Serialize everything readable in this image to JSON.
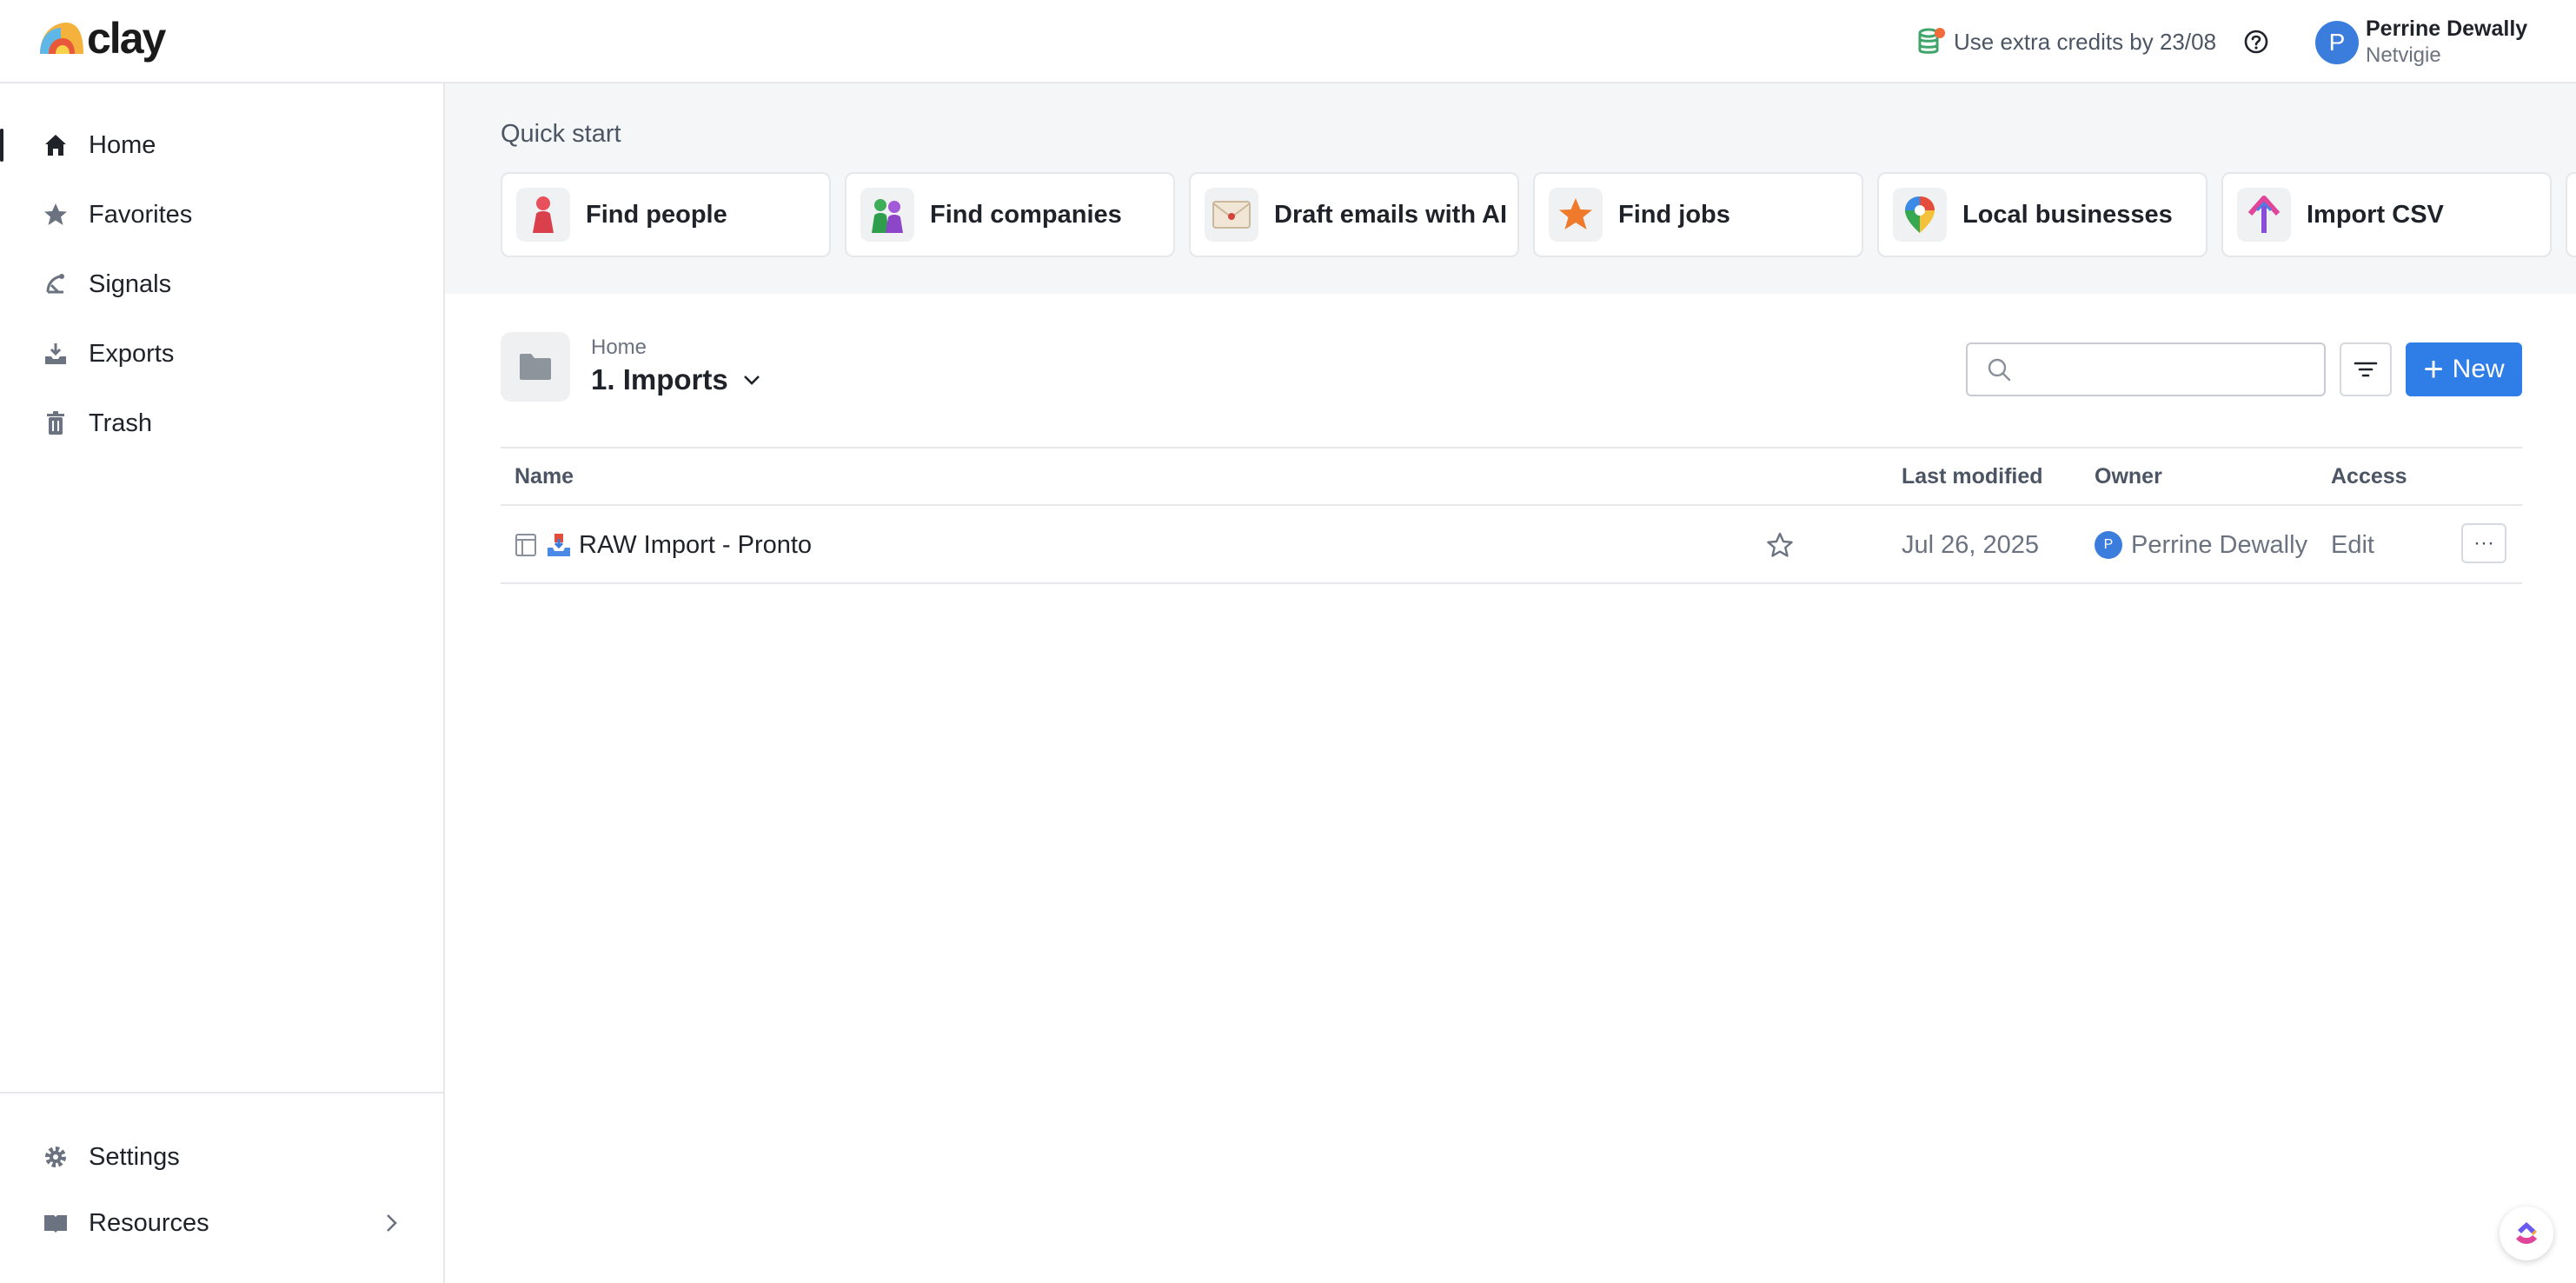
{
  "app": {
    "logo_text": "clay"
  },
  "topbar": {
    "credits_text": "Use extra credits by 23/08",
    "user": {
      "initial": "P",
      "name": "Perrine Dewally",
      "org": "Netvigie"
    }
  },
  "sidebar": {
    "items": [
      {
        "label": "Home",
        "icon": "home-icon",
        "active": true
      },
      {
        "label": "Favorites",
        "icon": "star-icon"
      },
      {
        "label": "Signals",
        "icon": "signal-icon"
      },
      {
        "label": "Exports",
        "icon": "export-tray-icon"
      },
      {
        "label": "Trash",
        "icon": "trash-icon"
      }
    ],
    "bottom": [
      {
        "label": "Settings",
        "icon": "gear-icon"
      },
      {
        "label": "Resources",
        "icon": "book-icon"
      }
    ]
  },
  "quickstart": {
    "title": "Quick start",
    "cards": [
      {
        "label": "Find people",
        "icon": "person-icon"
      },
      {
        "label": "Find companies",
        "icon": "people-group-icon"
      },
      {
        "label": "Draft emails with AI",
        "icon": "envelope-icon"
      },
      {
        "label": "Find jobs",
        "icon": "star-badge-icon"
      },
      {
        "label": "Local businesses",
        "icon": "map-pin-icon"
      },
      {
        "label": "Import CSV",
        "icon": "upload-arrow-icon"
      }
    ]
  },
  "folder": {
    "breadcrumb": "Home",
    "title": "1. Imports"
  },
  "toolbar": {
    "search_placeholder": "",
    "new_label": "New"
  },
  "table": {
    "columns": {
      "name": "Name",
      "modified": "Last modified",
      "owner": "Owner",
      "access": "Access"
    },
    "rows": [
      {
        "name": "RAW Import - Pronto",
        "modified": "Jul 26, 2025",
        "owner_initial": "P",
        "owner": "Perrine Dewally",
        "access": "Edit",
        "more": "···"
      }
    ]
  },
  "colors": {
    "accent": "#2f7de6",
    "avatar": "#3b7ddd"
  }
}
